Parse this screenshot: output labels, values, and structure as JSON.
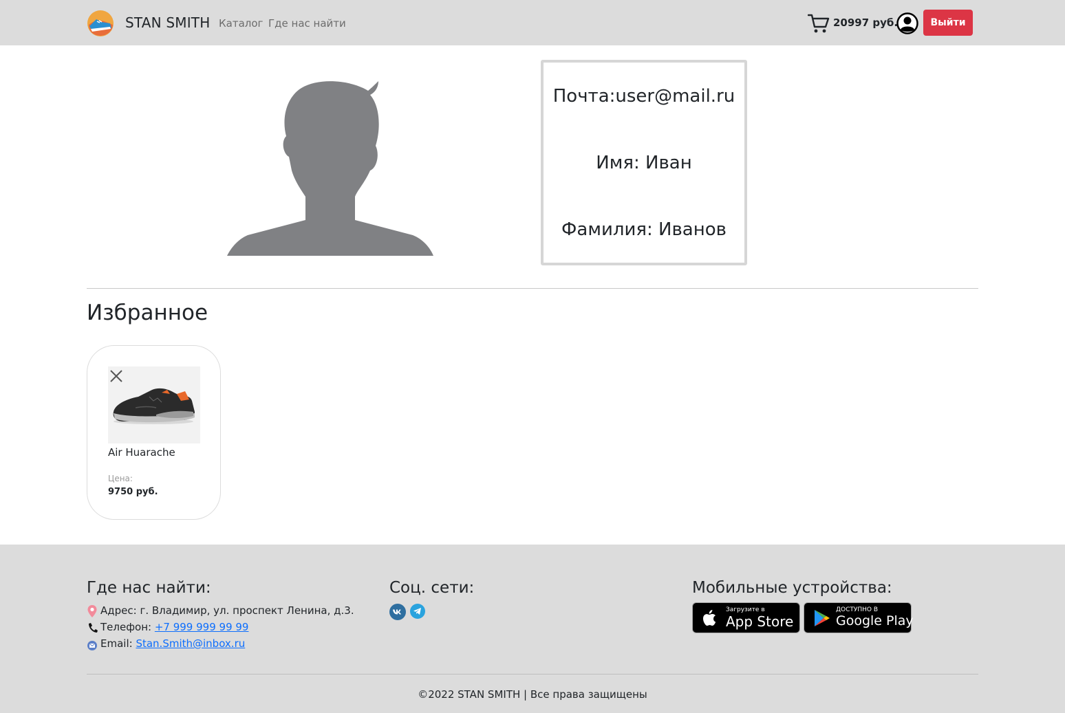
{
  "header": {
    "brand": "STAN SMITH",
    "nav": {
      "catalog": "Каталог",
      "find_us": "Где нас найти"
    },
    "cart_total": "20997 руб.",
    "logout_label": "Выйти"
  },
  "profile": {
    "email": "Почта:user@mail.ru",
    "name": "Имя: Иван",
    "surname": "Фамилия: Иванов"
  },
  "favorites": {
    "title": "Избранное",
    "items": [
      {
        "name": "Air Huarache",
        "price_label": "Цена:",
        "price": "9750 руб."
      }
    ]
  },
  "footer": {
    "find_heading": "Где нас найти:",
    "address": "Адрес: г. Владимир, ул. проспект Ленина, д.3.",
    "phone_label": "Телефон: ",
    "phone": "+7 999 999 99 99",
    "email_label": "Email: ",
    "email": "Stan.Smith@inbox.ru",
    "social_heading": "Соц. сети:",
    "mobile_heading": "Мобильные устройства:",
    "appstore_small": "Загрузите в",
    "appstore_big": "App Store",
    "googleplay_small": "ДОСТУПНО В",
    "googleplay_big": "Google Play",
    "copyright": "©2022 STAN SMITH | Все права защищены"
  },
  "colors": {
    "header_bg": "#dcdcdc",
    "logout_bg": "#dc3545",
    "link": "#0d6efd",
    "avatar": "#808184"
  }
}
